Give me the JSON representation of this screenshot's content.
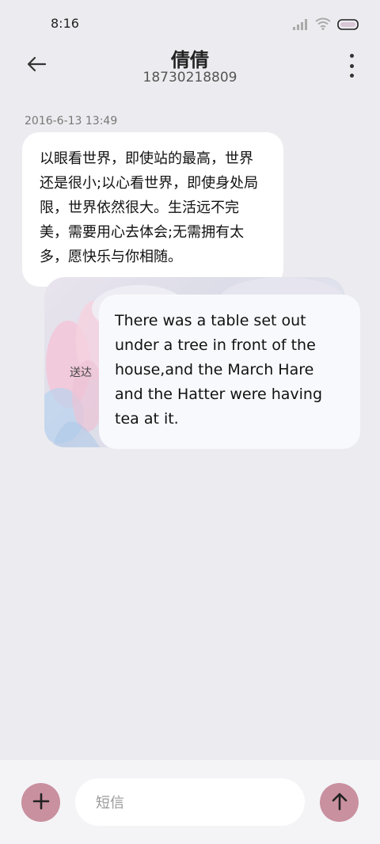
{
  "status_bar": {
    "time": "8:16",
    "icons": [
      "signal-icon",
      "wifi-icon",
      "battery-icon"
    ]
  },
  "header": {
    "contact_name": "倩倩",
    "contact_number": "18730218809",
    "back_icon": "arrow-left-icon",
    "more_icon": "more-vertical-icon"
  },
  "conversation": {
    "timestamp": "2016-6-13 13:49",
    "incoming_message": "以眼看世界，即使站的最高，世界还是很小;以心看世界，即使身处局限，世界依然很大。生活远不完美，需要用心去体会;无需拥有太多，愿快乐与你相随。",
    "outgoing_message": "There was a table set out under a tree in front of the house,and the March Hare and the Hatter were having tea at it.",
    "delivered_label": "送达"
  },
  "composer": {
    "placeholder": "短信",
    "add_icon": "plus-icon",
    "send_icon": "arrow-up-icon"
  },
  "colors": {
    "background": "#ececf0",
    "accent": "#c9909f",
    "bubble": "#ffffff"
  }
}
